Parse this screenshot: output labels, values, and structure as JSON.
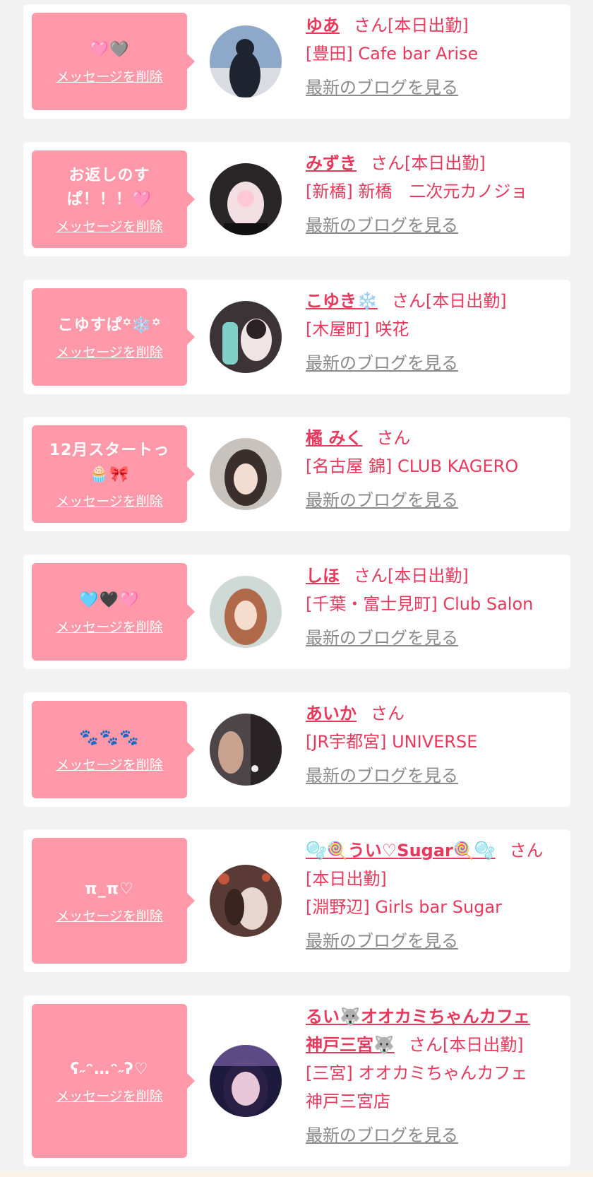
{
  "list": {
    "delete_label": "メッセージを削除",
    "blog_label": "最新のブログを見る",
    "items": [
      {
        "message": "🩷🩶",
        "name": "ゆあ",
        "name_suffix": "さん[本日出勤]",
        "shop": "[豊田] Cafe bar Arise",
        "avatar_colors": [
          "#8da8c8",
          "#d9dde3",
          "#1e2430"
        ]
      },
      {
        "message": "お返しのすぱ！！！🩷",
        "name": "みずき",
        "name_suffix": "さん[本日出勤]",
        "shop": "[新橋] 新橋　二次元カノジョ",
        "avatar_colors": [
          "#2a2526",
          "#f3dfe3",
          "#ffc8d6"
        ]
      },
      {
        "message": "こゆすぱ꙳❄️꙳",
        "name": "こゆき❄️",
        "name_suffix": "さん[本日出勤]",
        "shop": "[木屋町] 咲花",
        "avatar_colors": [
          "#3b3335",
          "#7fd0c8",
          "#f0e5e5"
        ]
      },
      {
        "message": "12月スタートっ🧁🎀",
        "name": "橘 みく",
        "name_suffix": "さん",
        "shop": "[名古屋 錦] CLUB KAGERO",
        "avatar_colors": [
          "#c8c2bf",
          "#3a2f2d",
          "#f3ddd2"
        ]
      },
      {
        "message": "🩵🖤🩷",
        "name": "しほ",
        "name_suffix": "さん[本日出勤]",
        "shop": "[千葉・富士見町] Club Salon",
        "avatar_colors": [
          "#cfdad6",
          "#b06a4a",
          "#f5dccd"
        ]
      },
      {
        "message": "🐾🐾🐾",
        "name": "あいか",
        "name_suffix": "さん",
        "shop": "[JR宇都宮] UNIVERSE",
        "avatar_colors": [
          "#4e4548",
          "#c9a28f",
          "#2a2326"
        ]
      },
      {
        "message": "π_π♡",
        "name": "🫧🍭うい♡Sugar🍭🫧",
        "name_suffix": "さん",
        "name_extra": "[本日出勤]",
        "shop": "[淵野辺] Girls bar Sugar",
        "avatar_colors": [
          "#5a3a34",
          "#e8d6d0",
          "#c2553e"
        ]
      },
      {
        "message": "ʕ˶ᵔ…ᵔ˶ʔ♡",
        "name": "るい🐺オオカミちゃんカフェ",
        "name_line2": "神戸三宮🐺",
        "name_suffix": "さん[本日出勤]",
        "shop": "[三宮] オオカミちゃんカフェ",
        "shop_line2": "神戸三宮店",
        "avatar_colors": [
          "#1e1a3e",
          "#9a7ad0",
          "#e8c8d8"
        ]
      }
    ]
  }
}
